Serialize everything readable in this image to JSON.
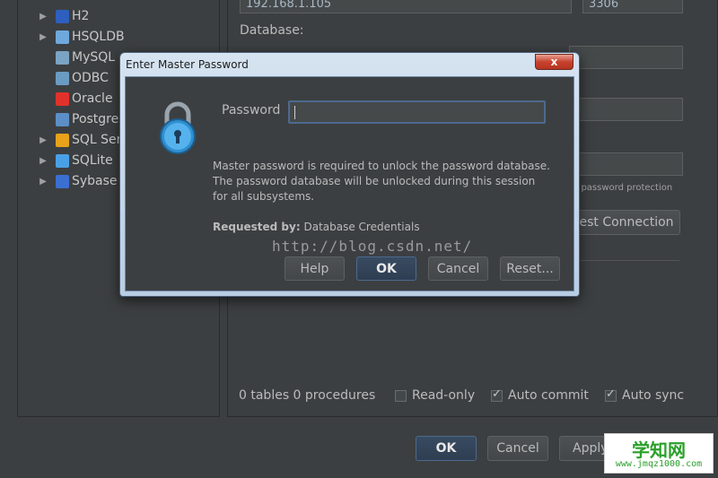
{
  "sidebar": {
    "items": [
      {
        "label": "H2",
        "icon": "h2-icon",
        "color": "#2d5fbf",
        "expandable": true
      },
      {
        "label": "HSQLDB",
        "icon": "hsqldb-icon",
        "color": "#6fa8dc",
        "expandable": true
      },
      {
        "label": "MySQL",
        "icon": "mysql-icon",
        "color": "#7aa3c4",
        "expandable": false
      },
      {
        "label": "ODBC",
        "icon": "odbc-icon",
        "color": "#6a9bc3",
        "expandable": false
      },
      {
        "label": "Oracle",
        "icon": "oracle-icon",
        "color": "#e0322a",
        "expandable": false
      },
      {
        "label": "Postgre",
        "icon": "postgres-icon",
        "color": "#5c8fc7",
        "expandable": false
      },
      {
        "label": "SQL Ser",
        "icon": "sqlserver-icon",
        "color": "#e8a21b",
        "expandable": true
      },
      {
        "label": "SQLite",
        "icon": "sqlite-icon",
        "color": "#4aa0e6",
        "expandable": true
      },
      {
        "label": "Sybase",
        "icon": "sybase-icon",
        "color": "#3b6fd1",
        "expandable": true
      }
    ]
  },
  "main": {
    "host_value": "192.168.1.105",
    "port_value": "3306",
    "database_label": "Database:",
    "protection_note": "er password protection",
    "test_connection_label": "est Connection",
    "summary": "0 tables 0 procedures",
    "readonly_label": "Read-only",
    "readonly_checked": false,
    "autocommit_label": "Auto commit",
    "autocommit_checked": true,
    "autosync_label": "Auto sync",
    "autosync_checked": true,
    "ok_label": "OK",
    "cancel_label": "Cancel",
    "apply_label": "Apply"
  },
  "dialog": {
    "title": "Enter Master Password",
    "close_label": "x",
    "password_label": "Password",
    "password_value": "",
    "message_line1": "Master password is required to unlock the password database.",
    "message_line2": "The password database will be unlocked during this session",
    "message_line3": "for all subsystems.",
    "requested_by_label": "Requested by:",
    "requested_by_value": "Database Credentials",
    "help_label": "Help",
    "ok_label": "OK",
    "cancel_label": "Cancel",
    "reset_label": "Reset..."
  },
  "watermark": "http://blog.csdn.net/",
  "logo": {
    "main": "学知网",
    "sub": "www.jmqz1000.com"
  },
  "colors": {
    "bg": "#3c3f41",
    "accent": "#4c6a8e"
  }
}
